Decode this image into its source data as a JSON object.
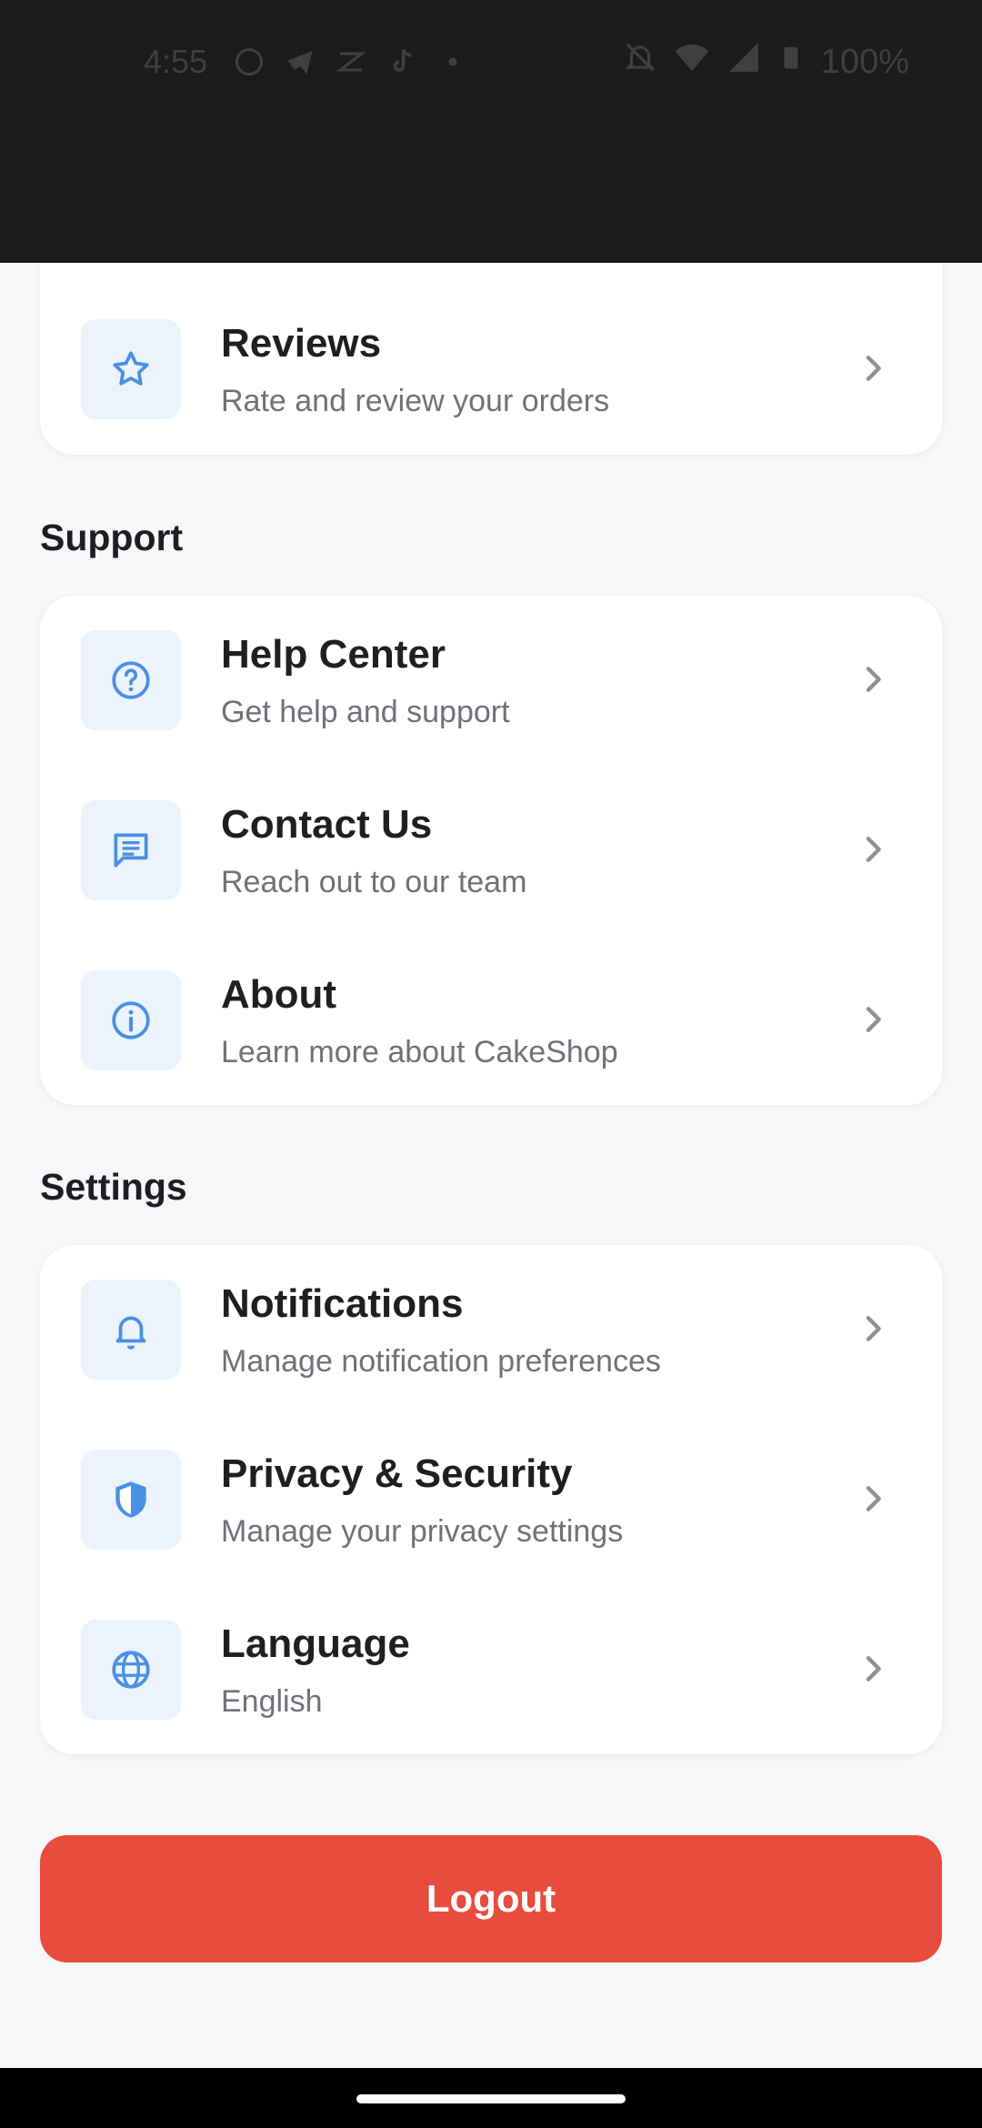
{
  "status_bar": {
    "time": "4:55",
    "battery": "100%"
  },
  "sections": {
    "account_tail": {
      "items": [
        {
          "title": "Reviews",
          "subtitle": "Rate and review your orders",
          "icon": "star-icon"
        }
      ]
    },
    "support": {
      "title": "Support",
      "items": [
        {
          "title": "Help Center",
          "subtitle": "Get help and support",
          "icon": "help-circle-icon"
        },
        {
          "title": "Contact Us",
          "subtitle": "Reach out to our team",
          "icon": "chat-icon"
        },
        {
          "title": "About",
          "subtitle": "Learn more about CakeShop",
          "icon": "info-icon"
        }
      ]
    },
    "settings": {
      "title": "Settings",
      "items": [
        {
          "title": "Notifications",
          "subtitle": "Manage notification preferences",
          "icon": "bell-icon"
        },
        {
          "title": "Privacy & Security",
          "subtitle": "Manage your privacy settings",
          "icon": "shield-icon"
        },
        {
          "title": "Language",
          "subtitle": "English",
          "icon": "globe-icon"
        }
      ]
    }
  },
  "logout_label": "Logout",
  "colors": {
    "accent": "#4a90e2",
    "icon_bg": "#edf3fd",
    "logout": "#e84c3d",
    "background": "#f6f7f9"
  }
}
